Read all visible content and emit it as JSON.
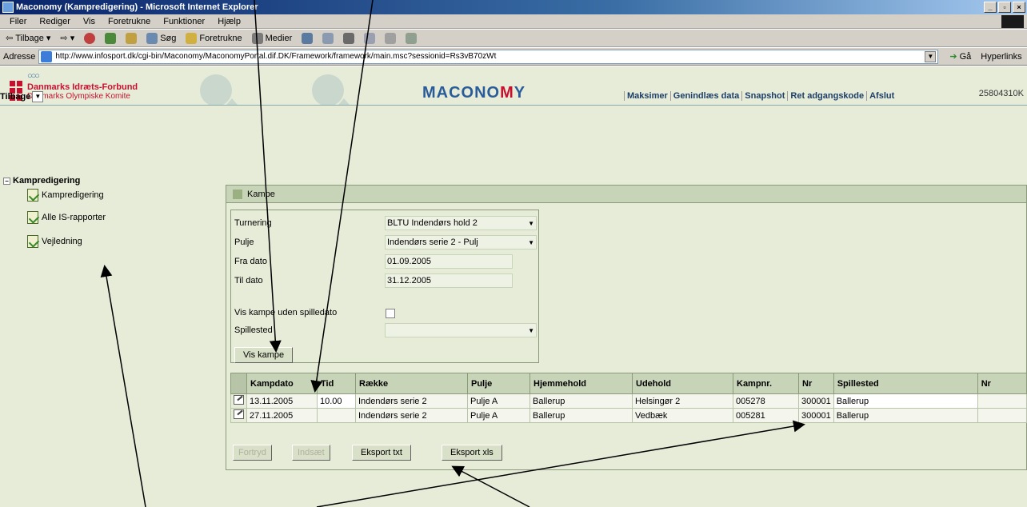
{
  "window": {
    "title": "Maconomy (Kampredigering) - Microsoft Internet Explorer",
    "buttons": [
      "_",
      "▫",
      "×"
    ]
  },
  "menu": [
    "Filer",
    "Rediger",
    "Vis",
    "Foretrukne",
    "Funktioner",
    "Hjælp"
  ],
  "toolbar": {
    "back": "Tilbage",
    "search": "Søg",
    "favorites": "Foretrukne",
    "media": "Medier"
  },
  "address": {
    "label": "Adresse",
    "url": "http://www.infosport.dk/cgi-bin/Maconomy/MaconomyPortal.dif.DK/Framework/framework/main.msc?sessionid=Rs3vB70zWt",
    "go": "Gå",
    "links": "Hyperlinks"
  },
  "header": {
    "org_title": "Danmarks Idræts-Forbund",
    "org_subtitle": "Danmarks Olympiske Komite",
    "brand_left": "MACONO",
    "brand_m": "M",
    "brand_right": "Y",
    "user_code": "25804310K"
  },
  "actionbar": {
    "back_label": "Tilbage",
    "actions": [
      "Maksimer",
      "Genindlæs data",
      "Snapshot",
      "Ret adgangskode",
      "Afslut"
    ]
  },
  "sidebar": {
    "root": "Kampredigering",
    "items": [
      "Kampredigering",
      "Alle IS-rapporter",
      "Vejledning"
    ]
  },
  "panel": {
    "title": "Kampe"
  },
  "form": {
    "turnering_label": "Turnering",
    "turnering_value": "BLTU Indendørs hold 2",
    "pulje_label": "Pulje",
    "pulje_value": "Indendørs serie 2 - Pulj",
    "fra_label": "Fra dato",
    "fra_value": "01.09.2005",
    "til_label": "Til dato",
    "til_value": "31.12.2005",
    "uden_label": "Vis kampe uden spilledato",
    "spillested_label": "Spillested",
    "show_button": "Vis kampe"
  },
  "table": {
    "headers": [
      "Kampdato",
      "Tid",
      "Række",
      "Pulje",
      "Hjemmehold",
      "Udehold",
      "Kampnr.",
      "Nr",
      "Spillested",
      "Nr"
    ],
    "rows": [
      [
        "13.11.2005",
        "10.00",
        "Indendørs serie 2",
        "Pulje A",
        "Ballerup",
        "Helsingør 2",
        "005278",
        "300001",
        "Ballerup",
        ""
      ],
      [
        "27.11.2005",
        "",
        "Indendørs serie 2",
        "Pulje A",
        "Ballerup",
        "Vedbæk",
        "005281",
        "300001",
        "Ballerup",
        ""
      ]
    ]
  },
  "bottom_buttons": [
    "Fortryd",
    "Indsæt",
    "Eksport txt",
    "Eksport xls"
  ],
  "colors": {
    "background": "#e6ecd8",
    "brand": "#2a5c9a",
    "accent_red": "#c8102e"
  }
}
